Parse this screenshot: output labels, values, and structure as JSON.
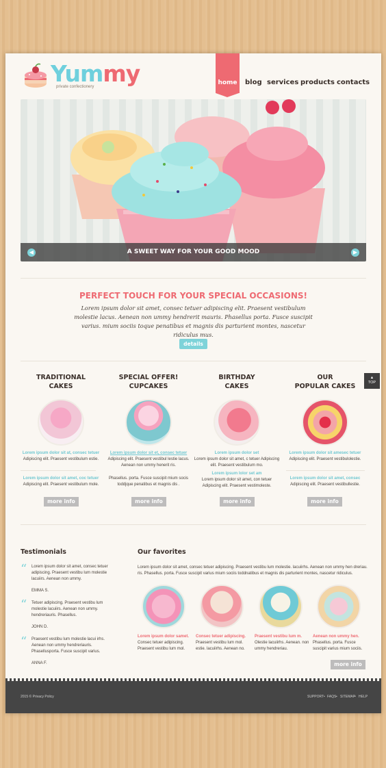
{
  "brand": {
    "name_part1": "Yum",
    "name_part2": "my",
    "tagline": "private confectionery"
  },
  "nav": {
    "items": [
      "home",
      "blog",
      "services",
      "products",
      "contacts"
    ],
    "active": "home"
  },
  "slider": {
    "caption": "A SWEET WAY FOR YOUR GOOD MOOD",
    "prev_icon": "arrow-left-icon",
    "next_icon": "arrow-right-icon"
  },
  "occasions": {
    "title": "PERFECT TOUCH FOR YOUR SPECIAL OCCASIONS!",
    "text": "Lorem ipsum dolor sit amet, consec tetuer adipiscing elit. Praesent vestibulum molestie lacus. Aenean non ummy hendrerit mauris. Phasellus porta. Fusce suscipit varius. mium sociis toque penatibus et magnis dis parturient montes, nascetur ridiculus mus.",
    "button": "details"
  },
  "columns": [
    {
      "title_line1": "TRADITIONAL",
      "title_line2": "CAKES",
      "link1": "Lorem ipsum dolor sit at, consec tetuer",
      "text1": "Adipiscing elit. Praesent vestibulum estie.",
      "link2": "Lorem ipsum dolor sit amet, coc tetuer",
      "text2": "Adipiscing elit. Praesent vestibulum mole.",
      "button": "more info"
    },
    {
      "title_line1": "SPECIAL OFFER!",
      "title_line2": "CUPCAKES",
      "link1": "Lorem ipsum dolor sit et, consec tetuer",
      "text1": "Adipiscing elit. Praesent vestibul lestie lacus. Aenean non ummy henerit ris.",
      "link2": "",
      "text2": "Phasellus. porta. Fusce suscipit mium socis toddjque penatibus et magnis dis .",
      "button": "more info"
    },
    {
      "title_line1": "BIRTHDAY",
      "title_line2": "CAKES",
      "link1": "Lorem ipsum dolor set",
      "text1": "Lorem ipsum dolor sit amet, c tetuer Adipiscing elit. Praesent vestibulum mo.",
      "link2": "Lorem ipsum lolor set am",
      "text2": "Lorem ipsum dolor sit amet, con tetuer Adipiscing elit. Praesent vestimoleste.",
      "button": "more info"
    },
    {
      "title_line1": "OUR",
      "title_line2": "POPULAR CAKES",
      "link1": "Lorem ipsum dolor sit amesec tetuer",
      "text1": "Adipiscing elit. Praesent vestibulolestie.",
      "link2": "Lorem ipsum dolor sit amet, consec",
      "text2": "Adipiscing elit. Praesent vestibullestie.",
      "button": "more info"
    }
  ],
  "top_button": "TOP",
  "testimonials": {
    "title": "Testimonials",
    "items": [
      {
        "text": "Lorem ipsum dolor sit amet, consec tetuer adipiscing. Praesent vestibu lum molestie lacuiirs. Aenean non ummy.",
        "name": "EMMA S."
      },
      {
        "text": "Tetuer adipiscing. Praesent vestibu lum molestie lacuiirs. Aenean non ummy. hendreriauris. Phasellus.",
        "name": "JOHN D."
      },
      {
        "text": "Praesent vestibu lum molestie lacui irhs. Aenean non ummy hendreriauris. Phasellusporta. Fusce suscipit varius.",
        "name": "ANNA F."
      }
    ]
  },
  "favorites": {
    "title": "Our favorites",
    "intro": "Lorem ipsum dolor sit amet, consec tetuer adipiscing. Praesent vestibu lum molestie. lacuiirhs. Aenean non ummy hen dreriau. ris. Phasellus. porta. Fusce suscipit varius mium sociis toddnatibus et magnis dis parturient montes, nascetur ridiculus.",
    "items": [
      {
        "title": "Lorem ipsum dolor samet.",
        "text": "Consec tetuer adipiscing. Praesent vestibu lum mol."
      },
      {
        "title": "Consec tetuer adipiscing.",
        "text": "Praesent vestibu lum mol. estie. lacuiirhs. Aenean no."
      },
      {
        "title": "Praesent vestibu lum m.",
        "text": "Olestie lacuiirhs. Aenean. non ummy hendreriau."
      },
      {
        "title": "Aenean non ummy hen.",
        "text": "Phasellus. porta. Fusce suscipit varius mium sociis."
      }
    ],
    "button": "more info"
  },
  "footer": {
    "copyright": "2015 © Privacy Policy",
    "links": [
      "SUPPORT",
      "FAQS",
      "SITEMAP",
      "HELP"
    ]
  },
  "colors": {
    "accent_pink": "#ee6a72",
    "accent_teal": "#7ed3d9",
    "footer": "#454545"
  }
}
